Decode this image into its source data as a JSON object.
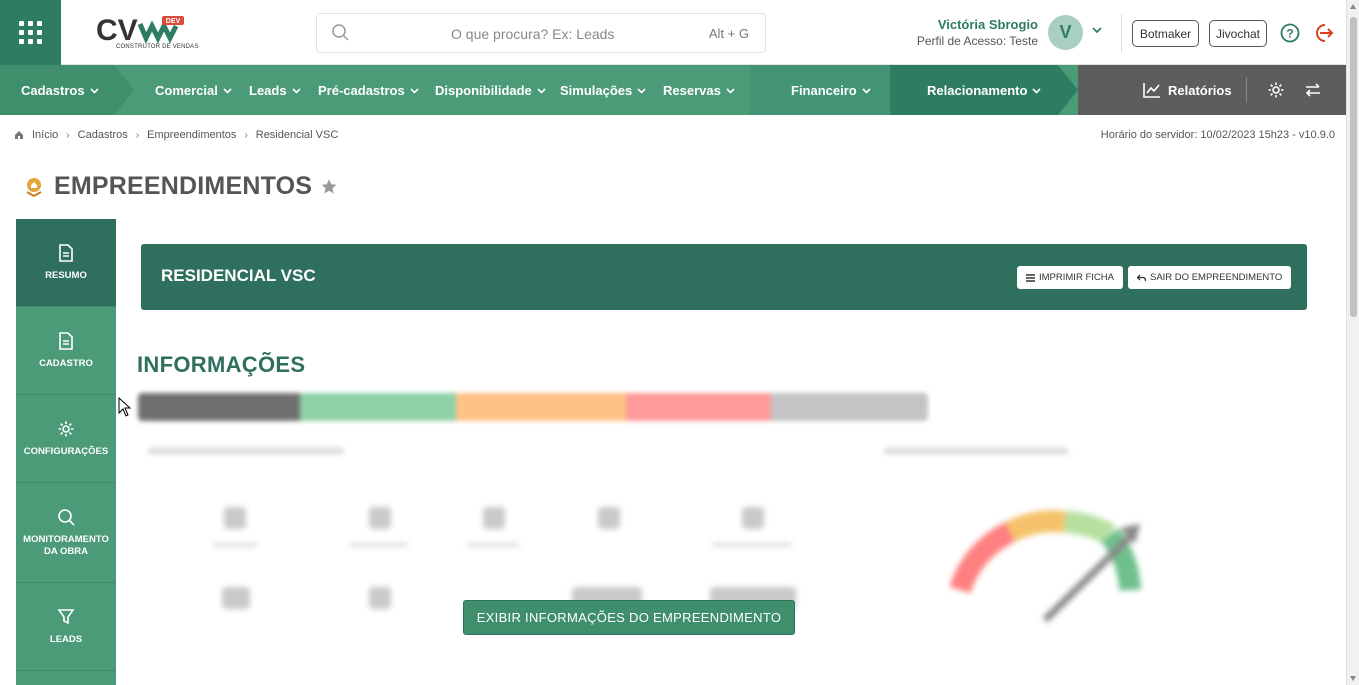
{
  "topbar": {
    "logo_text": "CV",
    "logo_badge": "DEV",
    "logo_subtitle": "CONSTRUTOR DE VENDAS",
    "search_placeholder": "O que procura? Ex: Leads",
    "search_shortcut": "Alt + G",
    "user_name": "Victória Sbrogio",
    "user_profile": "Perfil de Acesso: Teste",
    "avatar_initial": "V",
    "botmaker_label": "Botmaker",
    "jivochat_label": "Jivochat"
  },
  "navbar": {
    "items": [
      {
        "label": "Cadastros"
      },
      {
        "label": "Comercial"
      },
      {
        "label": "Leads"
      },
      {
        "label": "Pré-cadastros"
      },
      {
        "label": "Disponibilidade"
      },
      {
        "label": "Simulações"
      },
      {
        "label": "Reservas"
      },
      {
        "label": "Financeiro"
      },
      {
        "label": "Relacionamento"
      }
    ],
    "reports_label": "Relatórios"
  },
  "breadcrumb": {
    "items": [
      "Início",
      "Cadastros",
      "Empreendimentos",
      "Residencial VSC"
    ],
    "server_time": "Horário do servidor: 10/02/2023 15h23 - v10.9.0"
  },
  "page": {
    "title": "EMPREENDIMENTOS"
  },
  "sidebar": {
    "items": [
      {
        "label": "RESUMO",
        "icon": "document-icon"
      },
      {
        "label": "CADASTRO",
        "icon": "document-icon"
      },
      {
        "label": "CONFIGURAÇÕES",
        "icon": "gear-icon"
      },
      {
        "label": "MONITORAMENTO DA OBRA",
        "icon": "search-icon"
      },
      {
        "label": "LEADS",
        "icon": "filter-icon"
      }
    ]
  },
  "header_card": {
    "name": "RESIDENCIAL VSC",
    "print_label": "IMPRIMIR FICHA",
    "exit_label": "SAIR DO EMPREENDIMENTO"
  },
  "info": {
    "title": "INFORMAÇÕES",
    "show_button_label": "EXIBIR INFORMAÇÕES DO EMPREENDIMENTO"
  },
  "colors": {
    "primary": "#2e7d63",
    "nav": "#4b9b79",
    "card": "#2f6f5e",
    "logout": "#d9411e"
  }
}
